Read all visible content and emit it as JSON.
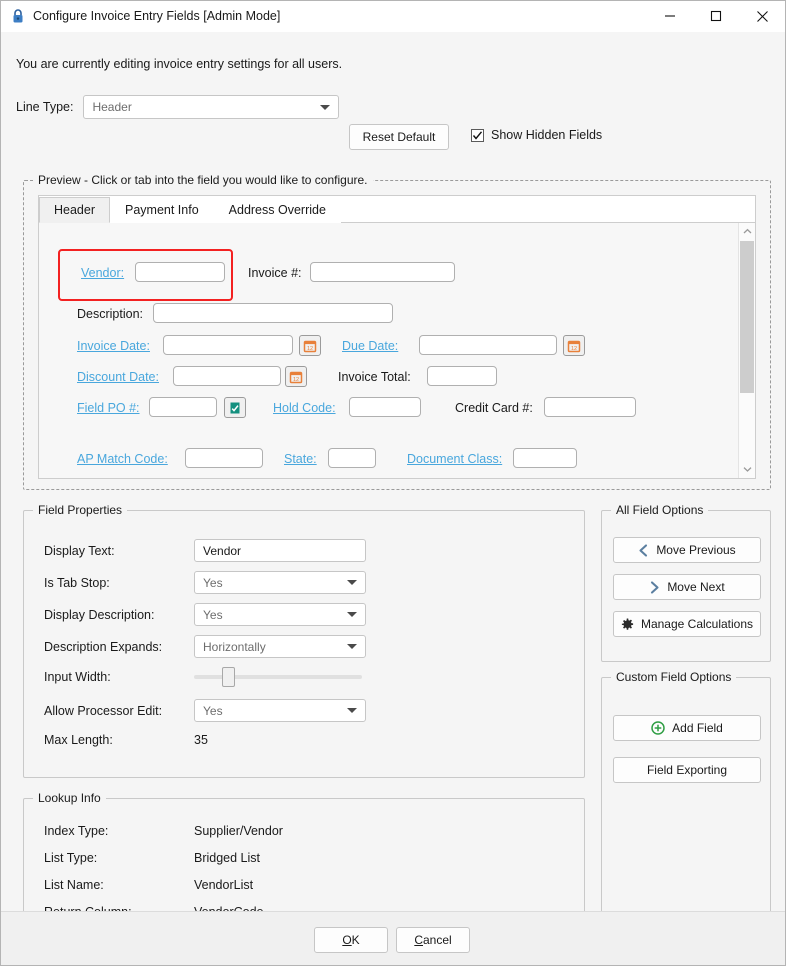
{
  "window": {
    "title": "Configure Invoice Entry Fields [Admin Mode]",
    "icon": "lock-icon",
    "controls": {
      "minimize": "minimize-icon",
      "maximize": "maximize-icon",
      "close": "close-icon"
    }
  },
  "notice": "You are currently editing invoice entry settings for all users.",
  "toolbar": {
    "line_type_label": "Line Type:",
    "line_type_value": "Header",
    "reset_default_label": "Reset Default",
    "show_hidden_label": "Show Hidden Fields",
    "show_hidden_checked": true
  },
  "preview": {
    "legend": "Preview - Click or tab into the field you would like to configure.",
    "tabs": [
      {
        "label": "Header",
        "active": true
      },
      {
        "label": "Payment Info",
        "active": false
      },
      {
        "label": "Address Override",
        "active": false
      }
    ],
    "fields": {
      "vendor": "Vendor:",
      "invoice_number": "Invoice #:",
      "description": "Description:",
      "invoice_date": "Invoice Date:",
      "due_date": "Due Date:",
      "discount_date": "Discount Date:",
      "invoice_total": "Invoice Total:",
      "field_po": "Field PO #:",
      "hold_code": "Hold Code:",
      "credit_card": "Credit Card #:",
      "ap_match_code": "AP Match Code:",
      "state": "State:",
      "document_class": "Document Class:"
    },
    "selected_field": "vendor",
    "icons": {
      "calendar": "calendar-icon",
      "po_lookup": "document-check-icon",
      "scroll_up": "chevron-up-icon",
      "scroll_down": "chevron-down-icon"
    }
  },
  "field_properties": {
    "legend": "Field Properties",
    "rows": [
      {
        "label": "Display Text:",
        "value": "Vendor",
        "type": "text"
      },
      {
        "label": "Is Tab Stop:",
        "value": "Yes",
        "type": "combo"
      },
      {
        "label": "Display Description:",
        "value": "Yes",
        "type": "combo"
      },
      {
        "label": "Description Expands:",
        "value": "Horizontally",
        "type": "combo"
      },
      {
        "label": "Input Width:",
        "value": "20",
        "type": "slider"
      },
      {
        "label": "Allow Processor Edit:",
        "value": "Yes",
        "type": "combo"
      },
      {
        "label": "Max Length:",
        "value": "35",
        "type": "static"
      }
    ]
  },
  "lookup_info": {
    "legend": "Lookup Info",
    "rows": [
      {
        "label": "Index Type:",
        "value": "Supplier/Vendor"
      },
      {
        "label": "List Type:",
        "value": "Bridged List"
      },
      {
        "label": "List Name:",
        "value": "VendorList"
      },
      {
        "label": "Return Column:",
        "value": "VendorCode"
      }
    ]
  },
  "all_field_options": {
    "legend": "All Field Options",
    "buttons": [
      {
        "label": "Move Previous",
        "icon": "chevron-left-icon"
      },
      {
        "label": "Move Next",
        "icon": "chevron-right-icon"
      },
      {
        "label": "Manage Calculations",
        "icon": "gear-icon"
      }
    ]
  },
  "custom_field_options": {
    "legend": "Custom Field Options",
    "buttons": [
      {
        "label": "Add Field",
        "icon": "plus-circle-icon"
      },
      {
        "label": "Field Exporting",
        "icon": ""
      }
    ]
  },
  "footer": {
    "ok_label": "OK",
    "ok_accel": "O",
    "cancel_label": "Cancel",
    "cancel_accel": "C"
  },
  "colors": {
    "link": "#49a7dd",
    "selection": "#f32121",
    "calendar": "#e8803a",
    "po_icon": "#13907f",
    "add_field": "#2f9e44",
    "chevron": "#5b7fa0"
  }
}
